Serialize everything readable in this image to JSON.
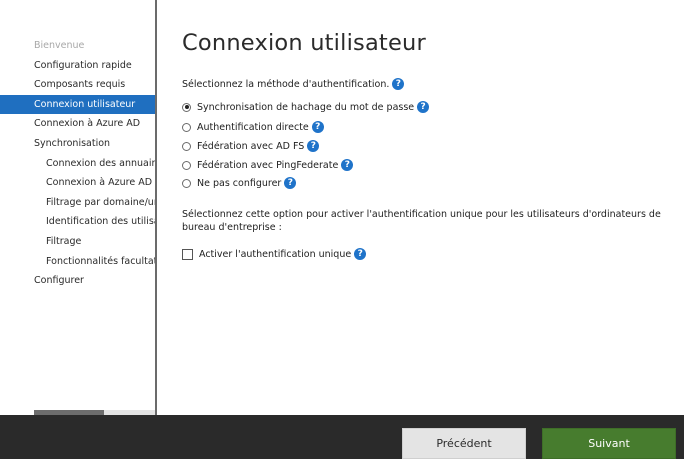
{
  "sidebar": {
    "items": [
      {
        "label": "Bienvenue"
      },
      {
        "label": "Configuration rapide"
      },
      {
        "label": "Composants requis"
      },
      {
        "label": "Connexion utilisateur"
      },
      {
        "label": "Connexion à Azure AD"
      },
      {
        "label": "Synchronisation"
      },
      {
        "label": "Connexion des annuaires"
      },
      {
        "label": "Connexion à Azure AD"
      },
      {
        "label": "Filtrage par domaine/unité d'organisation"
      },
      {
        "label": "Identification des utilisateurs"
      },
      {
        "label": "Filtrage"
      },
      {
        "label": "Fonctionnalités facultatives"
      },
      {
        "label": "Configurer"
      }
    ]
  },
  "main": {
    "title": "Connexion utilisateur",
    "auth_prompt": "Sélectionnez la méthode d'authentification.",
    "auth_options": [
      {
        "label": "Synchronisation de hachage du mot de passe",
        "selected": true
      },
      {
        "label": "Authentification directe",
        "selected": false
      },
      {
        "label": "Fédération avec AD FS",
        "selected": false
      },
      {
        "label": "Fédération avec PingFederate",
        "selected": false
      },
      {
        "label": "Ne pas configurer",
        "selected": false
      }
    ],
    "sso_description": "Sélectionnez cette option pour activer l'authentification unique pour les utilisateurs d'ordinateurs de bureau d'entreprise :",
    "sso_checkbox": {
      "label": "Activer l'authentification unique",
      "checked": false
    },
    "help_glyph": "?"
  },
  "footer": {
    "previous_label": "Précédent",
    "next_label": "Suivant"
  },
  "colors": {
    "accent": "#1f6fc0",
    "help_icon": "#1f73c9",
    "next_button": "#477c2e",
    "footer_bar": "#2a2a2a"
  },
  "icons": {
    "help": "help-circle-icon"
  }
}
